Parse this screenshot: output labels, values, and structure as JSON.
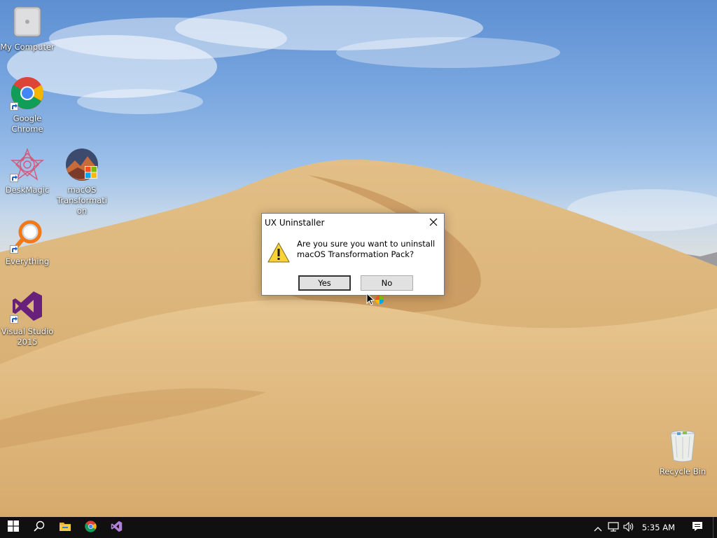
{
  "desktop": {
    "icons": [
      {
        "label": "My Computer",
        "icon": "computer-icon"
      },
      {
        "label": "Google Chrome",
        "icon": "chrome-icon"
      },
      {
        "label": "DeskMagic",
        "icon": "deskmagic-icon"
      },
      {
        "label": "macOS Transformation",
        "icon": "macos-transformation-icon"
      },
      {
        "label": "Everything",
        "icon": "everything-search-icon"
      },
      {
        "label": "Visual Studio 2015",
        "icon": "visual-studio-icon"
      },
      {
        "label": "Recycle Bin",
        "icon": "recycle-bin-icon"
      }
    ]
  },
  "dialog": {
    "title": "UX Uninstaller",
    "message_line1": "Are you sure you want to uninstall",
    "message_line2": "macOS Transformation Pack?",
    "yes_label": "Yes",
    "no_label": "No",
    "close_icon": "close-icon",
    "message_icon": "warning-icon"
  },
  "taskbar": {
    "start_icon": "windows-start-icon",
    "search_icon": "search-icon",
    "pinned": [
      {
        "name": "file-explorer",
        "icon": "folder-icon"
      },
      {
        "name": "google-chrome",
        "icon": "chrome-icon"
      },
      {
        "name": "visual-studio",
        "icon": "visual-studio-icon"
      }
    ],
    "tray": {
      "chevron_icon": "chevron-up-icon",
      "network_icon": "network-icon",
      "volume_icon": "volume-icon",
      "notification_icon": "action-center-icon"
    },
    "clock": "5:35 AM"
  },
  "colors": {
    "taskbar_bg": "#101010",
    "dialog_bg": "#ffffff",
    "button_bg": "#e1e1e1",
    "sand": "#d9b27a",
    "sky": "#6f9bd6"
  }
}
